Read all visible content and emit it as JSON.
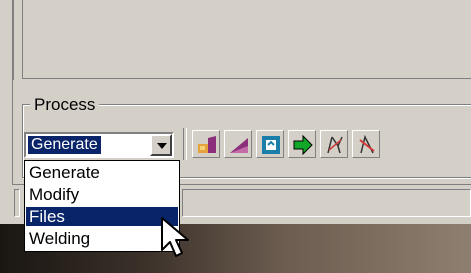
{
  "process_group": {
    "label": "Process"
  },
  "combo": {
    "value": "Generate"
  },
  "dropdown": {
    "items": [
      "Generate",
      "Modify",
      "Files",
      "Welding"
    ],
    "highlighted": "Files"
  },
  "toolbar": {
    "icons": [
      "generate-part-icon",
      "ramp-icon",
      "cycle-icon",
      "arrow-right-icon",
      "weld-path-icon",
      "weld-remove-icon"
    ]
  },
  "colors": {
    "window_bg": "#d4d0c8",
    "selection": "#0a246a",
    "selection_text": "#ffffff"
  }
}
